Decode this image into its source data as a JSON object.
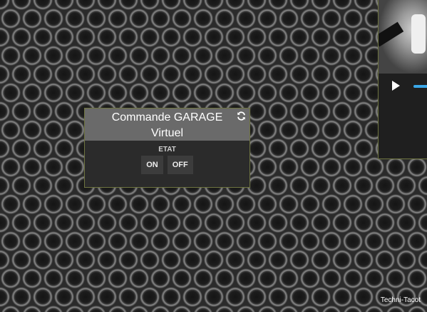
{
  "widget": {
    "title_line1": "Commande GARAGE",
    "title_line2": "Virtuel",
    "refresh_icon": "refresh-icon",
    "section_label": "ETAT",
    "on_label": "ON",
    "off_label": "OFF",
    "border_color": "#6e7440",
    "header_color": "#6a6a6a"
  },
  "video": {
    "play_icon": "play-icon",
    "progress_color": "#3aa7e8"
  },
  "footer": {
    "brand": "Techni-Tacot"
  }
}
